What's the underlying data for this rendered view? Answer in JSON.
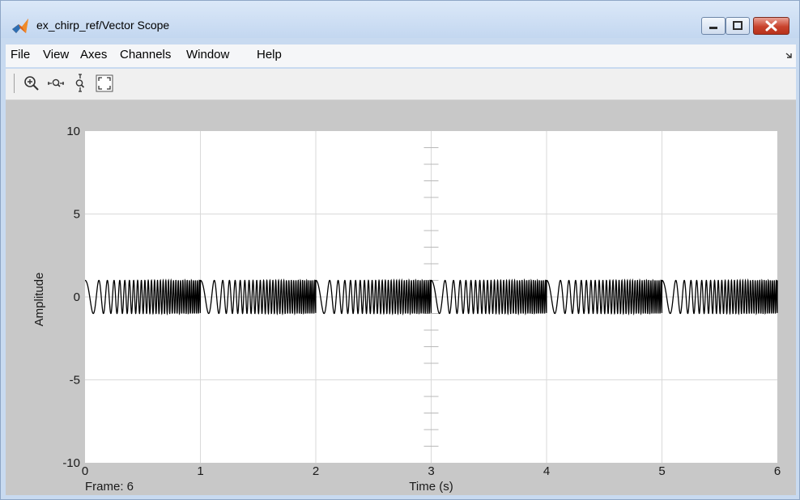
{
  "window": {
    "title": "ex_chirp_ref/Vector Scope",
    "app_icon": "matlab-logo-icon"
  },
  "window_controls": {
    "minimize": "minimize-icon",
    "maximize": "maximize-icon",
    "close": "close-icon"
  },
  "menu": {
    "items": [
      "File",
      "View",
      "Axes",
      "Channels",
      "Window",
      "Help"
    ],
    "overflow_icon": "dock-arrow-icon"
  },
  "toolbar": {
    "tools": [
      "zoom-in-icon",
      "zoom-x-icon",
      "zoom-y-icon",
      "autoscale-icon"
    ]
  },
  "status": {
    "frame_label": "Frame: 6"
  },
  "colors": {
    "trace": "#000000",
    "plot_background": "#ffffff",
    "figure_background": "#c8c8c8",
    "grid": "#d9d9d9"
  },
  "chart_data": {
    "type": "line",
    "title": "",
    "xlabel": "Time (s)",
    "ylabel": "Amplitude",
    "xlim": [
      0,
      6
    ],
    "ylim": [
      -10,
      10
    ],
    "x_ticks": [
      "0",
      "1",
      "2",
      "3",
      "4",
      "5",
      "6"
    ],
    "y_ticks": [
      "10",
      "5",
      "0",
      "-5",
      "-10"
    ],
    "grid": true,
    "series": [
      {
        "signal": "chirp",
        "amplitude": 1,
        "period_s": 1,
        "start_frequency_hz": 5,
        "end_frequency_hz": 60,
        "time_range": [
          0,
          6
        ]
      }
    ]
  }
}
